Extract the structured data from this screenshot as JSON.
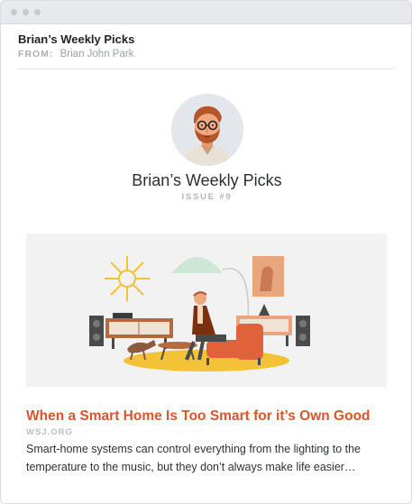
{
  "email": {
    "subject": "Brian’s Weekly Picks",
    "from_label": "FROM:",
    "from_name": "Brian John Park"
  },
  "newsletter": {
    "title": "Brian’s Weekly Picks",
    "issue": "ISSUE #9",
    "avatar_icon": "man-with-glasses-avatar"
  },
  "article": {
    "title": "When a Smart Home Is Too Smart for it’s Own Good",
    "source": "WSJ.ORG",
    "description": "Smart-home systems can control everything from the lighting to the temperature to the music, but they don’t always make life easier…",
    "image_icon": "smart-home-illustration"
  },
  "colors": {
    "accent": "#d9552a",
    "muted": "#b3b8bf",
    "hero_bg": "#f2f2f3"
  }
}
